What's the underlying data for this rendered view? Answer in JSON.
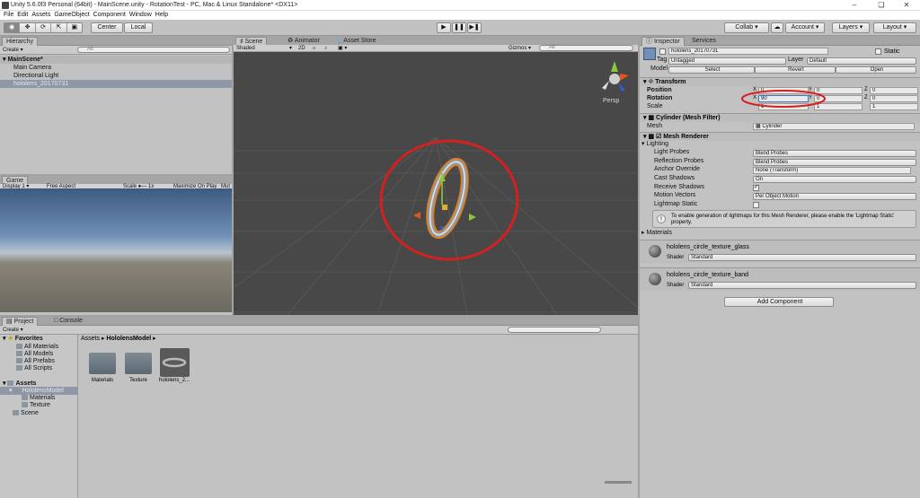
{
  "window": {
    "title": "Unity 5.6.0f3 Personal (64bit) - MainScene.unity - RotationTest - PC, Mac & Linux Standalone* <DX11>"
  },
  "menu": [
    "File",
    "Edit",
    "Assets",
    "GameObject",
    "Component",
    "Window",
    "Help"
  ],
  "toolbar": {
    "center": "Center",
    "local": "Local",
    "collab": "Collab",
    "account": "Account",
    "layers": "Layers",
    "layout": "Layout"
  },
  "hierarchy": {
    "tab": "Hierarchy",
    "create": "Create",
    "search_placeholder": "All",
    "scene": "MainScene*",
    "items": [
      "Main Camera",
      "Directional Light",
      "hololens_20170731"
    ]
  },
  "scene_view": {
    "tabs": [
      "Scene",
      "Animator",
      "Asset Store"
    ],
    "shaded": "Shaded",
    "mode2d": "2D",
    "gizmos": "Gizmos",
    "search_placeholder": "All",
    "persp": "Persp"
  },
  "game_view": {
    "tabs": [
      "Game"
    ],
    "display": "Display 1",
    "aspect": "Free Aspect",
    "scale_label": "Scale",
    "scale_value": "1x",
    "maximize": "Maximize On Play",
    "mute": "Mut"
  },
  "project": {
    "tabs": [
      "Project",
      "Console"
    ],
    "create": "Create",
    "favorites": "Favorites",
    "fav_items": [
      "All Materials",
      "All Models",
      "All Prefabs",
      "All Scripts"
    ],
    "assets": "Assets",
    "tree": [
      "HololensModel",
      "Materials",
      "Texture",
      "Scene"
    ],
    "breadcrumb_root": "Assets",
    "breadcrumb_current": "HololensModel",
    "files": [
      "Materials",
      "Texture",
      "hololens_2..."
    ]
  },
  "inspector": {
    "tabs": [
      "Inspector",
      "Services"
    ],
    "object_name": "hololens_20170731",
    "static_label": "Static",
    "tag_label": "Tag",
    "tag_value": "Untagged",
    "layer_label": "Layer",
    "layer_value": "Default",
    "model_label": "Model",
    "select": "Select",
    "revert": "Revert",
    "open": "Open",
    "transform": {
      "title": "Transform",
      "position": "Position",
      "rotation": "Rotation",
      "scale": "Scale",
      "pos": {
        "x": "0",
        "y": "0",
        "z": "0"
      },
      "rot": {
        "x": "90",
        "y": "0",
        "z": "0"
      },
      "scl": {
        "x": "1",
        "y": "1",
        "z": "1"
      }
    },
    "mesh_filter": {
      "title": "Cylinder (Mesh Filter)",
      "mesh_label": "Mesh",
      "mesh_value": "Cylinder"
    },
    "mesh_renderer": {
      "title": "Mesh Renderer",
      "lighting": "Lighting",
      "rows": [
        {
          "label": "Light Probes",
          "value": "Blend Probes"
        },
        {
          "label": "Reflection Probes",
          "value": "Blend Probes"
        },
        {
          "label": "Anchor Override",
          "value": "None (Transform)"
        },
        {
          "label": "Cast Shadows",
          "value": "On"
        },
        {
          "label": "Receive Shadows",
          "value": ""
        },
        {
          "label": "Motion Vectors",
          "value": "Per Object Motion"
        },
        {
          "label": "Lightmap Static",
          "value": ""
        }
      ],
      "info": "To enable generation of lightmaps for this Mesh Renderer, please enable the 'Lightmap Static' property.",
      "materials": "Materials"
    },
    "mat1": {
      "name": "hololens_circle_texture_glass",
      "shader_label": "Shader",
      "shader": "Standard"
    },
    "mat2": {
      "name": "hololens_circle_texture_band",
      "shader_label": "Shader",
      "shader": "Standard"
    },
    "add_component": "Add Component"
  },
  "colors": {
    "highlight": "#d4201e",
    "scene_bg": "#484848",
    "selection": "#8e98a8"
  }
}
